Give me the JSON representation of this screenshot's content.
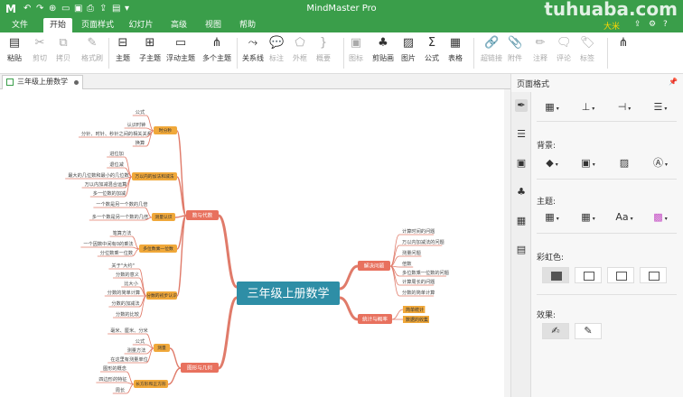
{
  "app": {
    "title": "MindMaster Pro",
    "watermark": "tuhuaba.com",
    "user": "大米"
  },
  "menu": [
    "文件",
    "开始",
    "页面样式",
    "幻灯片",
    "高级",
    "视图",
    "帮助"
  ],
  "menu_active": 1,
  "ribbon": [
    {
      "name": "paste",
      "label": "粘贴",
      "icon": "▤",
      "disabled": false
    },
    {
      "name": "cut",
      "label": "剪切",
      "icon": "✂",
      "disabled": true
    },
    {
      "name": "copy",
      "label": "拷贝",
      "icon": "⧉",
      "disabled": true
    },
    {
      "name": "format-painter",
      "label": "格式刷",
      "icon": "✎",
      "disabled": true
    },
    {
      "name": "topic",
      "label": "主题",
      "icon": "⊟",
      "disabled": false
    },
    {
      "name": "subtopic",
      "label": "子主题",
      "icon": "⊞",
      "disabled": false
    },
    {
      "name": "floating-topic",
      "label": "浮动主题",
      "icon": "▭",
      "disabled": false
    },
    {
      "name": "multiple-topics",
      "label": "多个主题",
      "icon": "⋔",
      "disabled": false
    },
    {
      "name": "relationship",
      "label": "关系线",
      "icon": "⤳",
      "disabled": false
    },
    {
      "name": "callout",
      "label": "标注",
      "icon": "💬",
      "disabled": true
    },
    {
      "name": "boundary",
      "label": "外框",
      "icon": "⬠",
      "disabled": true
    },
    {
      "name": "summary",
      "label": "概要",
      "icon": "}",
      "disabled": true
    },
    {
      "name": "icon",
      "label": "图标",
      "icon": "▣",
      "disabled": true
    },
    {
      "name": "clipart",
      "label": "剪贴画",
      "icon": "♣",
      "disabled": false
    },
    {
      "name": "image",
      "label": "图片",
      "icon": "▨",
      "disabled": false
    },
    {
      "name": "formula",
      "label": "公式",
      "icon": "Σ",
      "disabled": false
    },
    {
      "name": "table",
      "label": "表格",
      "icon": "▦",
      "disabled": false
    },
    {
      "name": "hyperlink",
      "label": "超链接",
      "icon": "🔗",
      "disabled": true
    },
    {
      "name": "attachment",
      "label": "附件",
      "icon": "📎",
      "disabled": true
    },
    {
      "name": "note",
      "label": "注释",
      "icon": "✏",
      "disabled": true
    },
    {
      "name": "comment",
      "label": "评论",
      "icon": "🗨",
      "disabled": true
    },
    {
      "name": "tag",
      "label": "标签",
      "icon": "🏷",
      "disabled": true
    },
    {
      "name": "layout",
      "label": "",
      "icon": "⋔",
      "disabled": false
    }
  ],
  "document_tab": "三年级上册数学",
  "panel": {
    "title": "页面格式",
    "pin": "📌",
    "background_label": "背景:",
    "theme_label": "主题:",
    "rainbow_label": "彩虹色:",
    "effect_label": "效果:"
  },
  "colors": {
    "brand": "#3a9e4a",
    "central": "#2e8ea6",
    "main_branch": "#e8715e",
    "sub_branch": "#f0a83a",
    "line": "#e07b6a"
  },
  "mindmap": {
    "central": "三年级上册数学",
    "branches": [
      {
        "label": "数与代数",
        "children": [
          {
            "label": "时分秒",
            "children": [
              "公式",
              "认识时钟",
              "分针、时针、秒针之间的相关关系",
              "换算"
            ]
          },
          {
            "label": "万以内的加法和减法",
            "children": [
              "进位加",
              "退位减",
              "最大的几位数和最小的几位数",
              "万以内加减混合运算",
              "多一位数的加减"
            ]
          },
          {
            "label": "测量认识",
            "children": [
              "一个数是另一个数的几倍",
              "多一个数是另一个数的几倍"
            ]
          },
          {
            "label": "多位数乘一位数",
            "children": [
              "笔算方法",
              "一个因数中间有0的乘法",
              "分位数乘一位数"
            ]
          },
          {
            "label": "分数的初步认识",
            "children": [
              "关于\"大约\"",
              "分数的意义",
              "比大小",
              "分数的简单计算",
              "分数的加减法",
              "分数的比较"
            ]
          }
        ]
      },
      {
        "label": "图形与几何",
        "children": [
          {
            "label": "测量",
            "children": [
              "毫米、厘米、分米",
              "公式",
              "测量方法",
              "在这里有测量单位"
            ]
          },
          {
            "label": "长方形和正方形",
            "children": [
              "图形的概念",
              "四边形的特征",
              "周长"
            ]
          }
        ]
      },
      {
        "label": "解决问题",
        "children": [
          "计算时间的问题",
          "万以内加减法的问题",
          "测量问题",
          "倍数",
          "多位数乘一位数的问题",
          "计算周长的问题",
          "分数的简单计算"
        ]
      },
      {
        "label": "统计与概率",
        "children": [
          "简单统计",
          "数据的收集"
        ]
      }
    ]
  }
}
